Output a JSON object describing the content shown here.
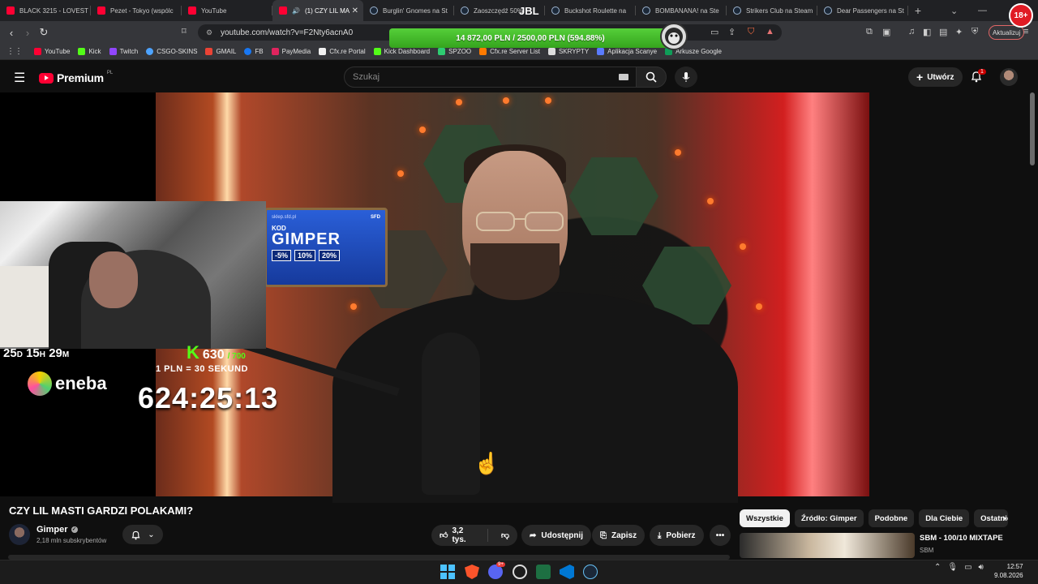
{
  "browser": {
    "tabs": [
      {
        "label": "BLACK 3215 - LOVEST",
        "icon": "youtube-icon",
        "active": false
      },
      {
        "label": "Pezet - Tokyo (wspólc",
        "icon": "youtube-icon",
        "active": false
      },
      {
        "label": "YouTube",
        "icon": "youtube-icon",
        "active": false
      },
      {
        "label": "(1) CZY LIL MA",
        "icon": "youtube-icon",
        "active": true
      },
      {
        "label": "Burglin' Gnomes na St",
        "icon": "steam-icon",
        "active": false
      },
      {
        "label": "Zaoszczędź 50%",
        "icon": "steam-icon",
        "active": false
      },
      {
        "label": "Buckshot Roulette na",
        "icon": "steam-icon",
        "active": false
      },
      {
        "label": "BOMBANANA! na Ste",
        "icon": "steam-icon",
        "active": false
      },
      {
        "label": "Strikers Club na Steam",
        "icon": "steam-icon",
        "active": false
      },
      {
        "label": "Dear Passengers na St",
        "icon": "steam-icon",
        "active": false
      }
    ],
    "new_tab": "+",
    "url": "youtube.com/watch?v=F2Nty6acnA0",
    "update_label": "Aktualizuj",
    "bookmarks": [
      {
        "label": "YouTube",
        "color": "#ff0033"
      },
      {
        "label": "Kick",
        "color": "#53fc18"
      },
      {
        "label": "Twitch",
        "color": "#9146ff"
      },
      {
        "label": "CSGO-SKINS",
        "color": "#4da3ff"
      },
      {
        "label": "GMAIL",
        "color": "#ea4335"
      },
      {
        "label": "FB",
        "color": "#1877f2"
      },
      {
        "label": "PayMedia",
        "color": "#e0245e"
      },
      {
        "label": "Cfx.re Portal",
        "color": "#f0f0f0"
      },
      {
        "label": "Kick Dashboard",
        "color": "#53fc18"
      },
      {
        "label": "SPZOO",
        "color": "#2ecc71"
      },
      {
        "label": "Cfx.re Server List",
        "color": "#ff7a00"
      },
      {
        "label": "SKRYPTY",
        "color": "#dddddd"
      },
      {
        "label": "Aplikacja Scanye",
        "color": "#5a7bff"
      },
      {
        "label": "Arkusze Google",
        "color": "#0f9d58"
      }
    ]
  },
  "overlay": {
    "donation_bar": "14 872,00 PLN / 2500,00 PLN  (594.88%)",
    "jbl": "JBL",
    "age_badge": "18+",
    "countdown": {
      "d": "25",
      "d_unit": "D",
      "h": "15",
      "h_unit": "H",
      "m": "29",
      "m_unit": "M"
    },
    "eneba": "eneba",
    "kick_letter": "K",
    "kick_subs": "630",
    "kick_goal": "/ 700",
    "rate": "1 PLN = 30 SEKUND",
    "timer": "624:25:13",
    "sign": {
      "url": "sklep.sfd.pl",
      "brand": "SFD",
      "kod": "KOD",
      "name": "GIMPER",
      "pcts": [
        "-5%",
        "10%",
        "20%"
      ]
    }
  },
  "youtube": {
    "logo": "Premium",
    "logo_region": "PL",
    "search_placeholder": "Szukaj",
    "create_label": "Utwórz",
    "notifications": "1",
    "video_title": "CZY LIL MASTI GARDZI POLAKAMI?",
    "channel": "Gimper",
    "subscribers": "2,18 mln subskrybentów",
    "likes": "3,2 tys.",
    "share_label": "Udostępnij",
    "save_label": "Zapisz",
    "download_label": "Pobierz",
    "more_label": "•••",
    "chips": [
      "Wszystkie",
      "Źródło: Gimper",
      "Podobne",
      "Dla Ciebie",
      "Ostatnio"
    ],
    "rec_title": "SBM - 100/10 MIXTAPE",
    "rec_channel": "SBM"
  },
  "taskbar": {
    "time": "12:57",
    "date": "9.08.2026",
    "discord_badge": "9+"
  }
}
